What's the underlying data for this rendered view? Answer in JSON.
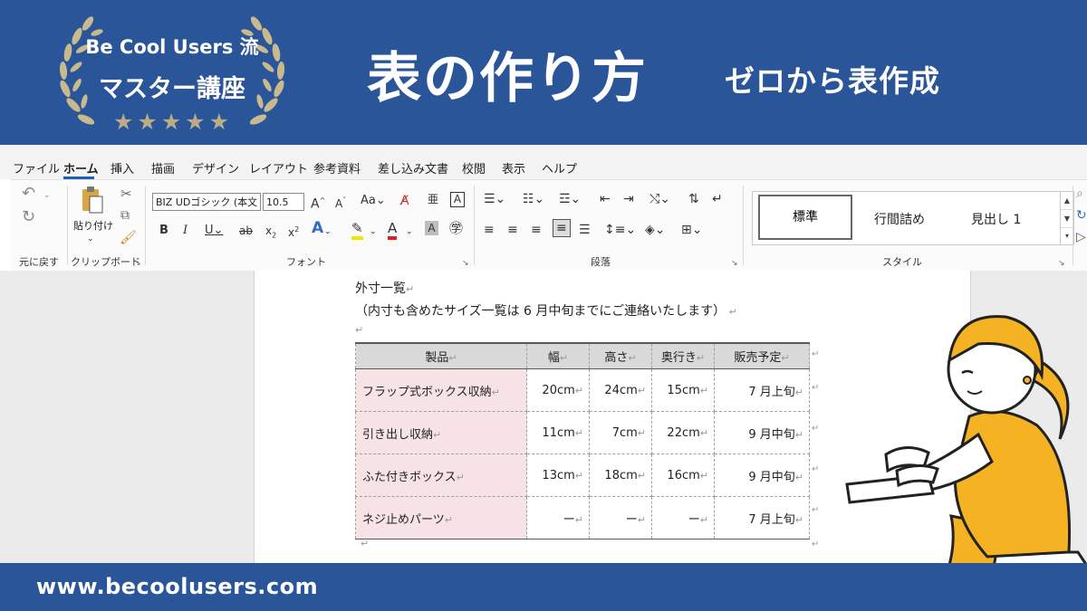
{
  "header": {
    "badge_line1": "Be Cool Users 流",
    "badge_line2": "マスター講座",
    "stars": "★★★★★",
    "title": "表の作り方",
    "subtitle": "ゼロから表作成"
  },
  "menu": {
    "tabs": [
      "ファイル",
      "ホーム",
      "挿入",
      "描画",
      "デザイン",
      "レイアウト",
      "参考資料",
      "差し込み文書",
      "校閲",
      "表示",
      "ヘルプ"
    ],
    "active": "ホーム"
  },
  "ribbon": {
    "undo_label": "元に戻す",
    "clipboard_label": "クリップボード",
    "paste_label": "貼り付け",
    "font_label": "フォント",
    "paragraph_label": "段落",
    "style_label": "スタイル",
    "font_name": "BIZ UDゴシック (本文",
    "font_size": "10.5",
    "styles": [
      "標準",
      "行間詰め",
      "見出し 1"
    ]
  },
  "document": {
    "heading": "外寸一覧",
    "note": "（内寸も含めたサイズ一覧は 6 月中旬までにご連絡いたします）",
    "table": {
      "headers": [
        "製品",
        "幅",
        "高さ",
        "奥行き",
        "販売予定"
      ],
      "rows": [
        [
          "フラップ式ボックス収納",
          "20cm",
          "24cm",
          "15cm",
          "7 月上旬"
        ],
        [
          "引き出し収納",
          "11cm",
          "7cm",
          "22cm",
          "9 月中旬"
        ],
        [
          "ふた付きボックス",
          "13cm",
          "18cm",
          "16cm",
          "9 月中旬"
        ],
        [
          "ネジ止めパーツ",
          "ー",
          "ー",
          "ー",
          "7 月上旬"
        ]
      ]
    }
  },
  "colors": {
    "brand_blue": "#2a5599",
    "product_cell": "#f7e3e6",
    "header_cell": "#d9d9d9",
    "illustration_yellow": "#f5b323"
  },
  "footer": {
    "url": "www.becoolusers.com"
  }
}
